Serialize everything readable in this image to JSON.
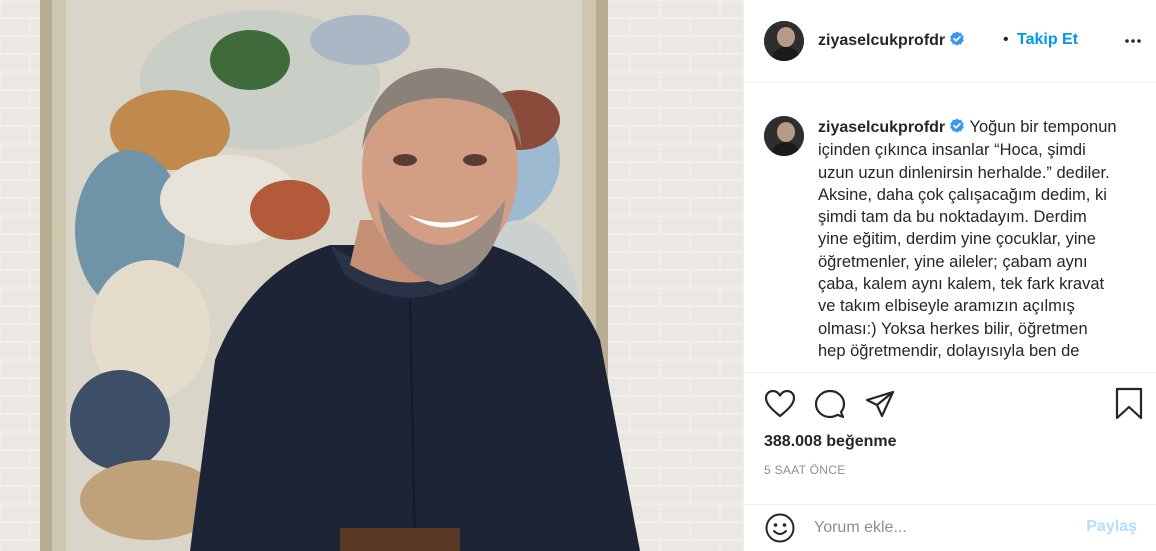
{
  "post": {
    "username": "ziyaselcukprofdr",
    "follow_separator": "•",
    "follow_label": "Takip Et",
    "more_icon": "more-horizontal-icon",
    "caption_text": "Yoğun bir temponun içinden çıkınca insanlar “Hoca, şimdi uzun uzun dinlenirsin herhalde.” dediler. Aksine, daha çok çalışacağım dedim, ki şimdi tam da bu noktadayım. Derdim yine eğitim, derdim yine çocuklar, yine öğretmenler, yine aileler; çabam aynı çaba, kalem aynı kalem, tek fark kravat ve takım elbiseyle aramızın açılmış olması:) Yoksa herkes bilir, öğretmen hep öğretmendir, dolayısıyla ben de",
    "likes": "388.008 beğenme",
    "time": "5 SAAT ÖNCE"
  },
  "comment": {
    "placeholder": "Yorum ekle...",
    "post_label": "Paylaş"
  },
  "icons": {
    "like": "heart-icon",
    "comment": "comment-icon",
    "share": "share-icon",
    "save": "bookmark-icon",
    "emoji": "emoji-icon",
    "verified": "verified-badge-icon"
  },
  "colors": {
    "accent": "#0095f6",
    "verified": "#3897f0",
    "muted": "#8e8e8e",
    "post_disabled": "#b2dffc"
  }
}
